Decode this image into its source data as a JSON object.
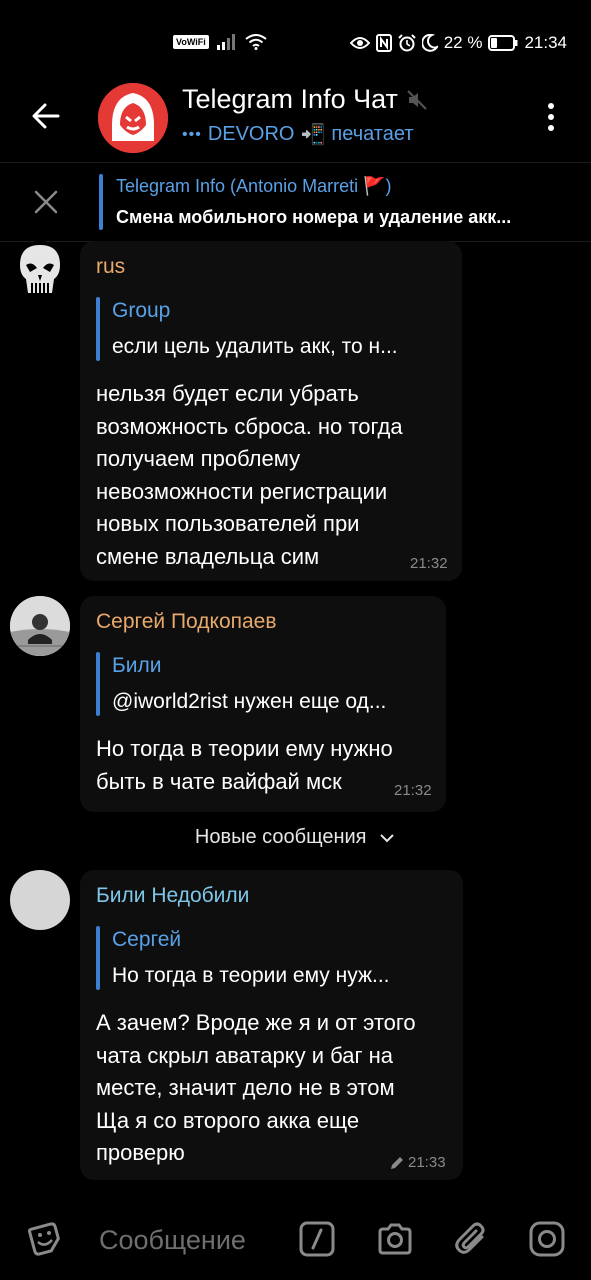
{
  "status_bar": {
    "vowifi": "VoWiFi",
    "battery_percent": "22 %",
    "time": "21:34"
  },
  "header": {
    "title": "Telegram Info Чат",
    "subtitle_user": "DEVORO",
    "subtitle_emoji": "📲",
    "subtitle_action": "печатает"
  },
  "pinned": {
    "title": "Telegram Info (Antonio Marreti 🚩)",
    "text": "Смена мобильного номера и удаление акк..."
  },
  "messages": [
    {
      "author": "rus",
      "author_color": "#e8a96a",
      "reply_name": "Group",
      "reply_text": "если цель удалить акк, то н...",
      "text": "нельзя будет если убрать\nвозможность сброса. но тогда\nполучаем проблему\nневозможности регистрации\nновых пользователей при\nсмене владельца сим",
      "time": "21:32"
    },
    {
      "author": "Сергей Подкопаев",
      "author_color": "#e8a96a",
      "reply_name": "Били",
      "reply_text": "@iworld2rist нужен еще од...",
      "text": "Но тогда в теории ему нужно\nбыть в чате вайфай мск",
      "time": "21:32"
    },
    {
      "author": "Били Недобили",
      "author_color": "#7fc7e8",
      "reply_name": "Сергей",
      "reply_text": "Но тогда в теории ему нуж...",
      "text": "А зачем? Вроде же я и от этого\nчата скрыл аватарку и баг на\nместе, значит дело не в этом\nЩа я со второго акка еще\nпроверю",
      "time": "21:33"
    }
  ],
  "new_messages_label": "Новые сообщения",
  "input": {
    "placeholder": "Сообщение"
  },
  "colors": {
    "accent": "#5aa0e6",
    "reply_bar": "#3d7fd1",
    "bubble": "#0e0e0e",
    "background": "#000000"
  },
  "icons": [
    "back-arrow-icon",
    "more-vert-icon",
    "close-icon",
    "sticker-icon",
    "slash-command-icon",
    "camera-icon",
    "attach-icon",
    "instagram-icon",
    "muted-icon",
    "chevron-down-icon",
    "edited-pencil-icon"
  ]
}
